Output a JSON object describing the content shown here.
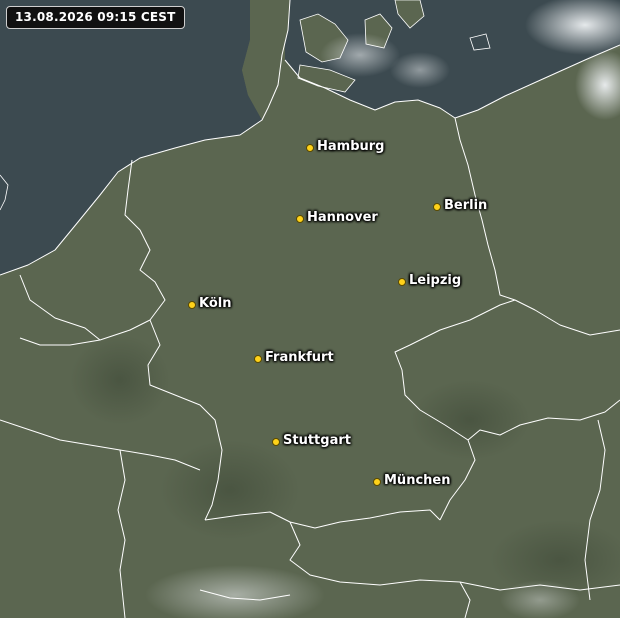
{
  "map": {
    "timestamp": "13.08.2026 09:15 CEST",
    "colors": {
      "land": "#5b6650",
      "sea": "#3c4a50",
      "borders": "#ffffff",
      "city_dot": "#ffd21a",
      "clouds": "#e8ecef"
    },
    "cities": [
      {
        "key": "hamburg",
        "name": "Hamburg"
      },
      {
        "key": "hannover",
        "name": "Hannover"
      },
      {
        "key": "berlin",
        "name": "Berlin"
      },
      {
        "key": "leipzig",
        "name": "Leipzig"
      },
      {
        "key": "koeln",
        "name": "Köln"
      },
      {
        "key": "frankfurt",
        "name": "Frankfurt"
      },
      {
        "key": "stuttgart",
        "name": "Stuttgart"
      },
      {
        "key": "muenchen",
        "name": "München"
      }
    ]
  }
}
